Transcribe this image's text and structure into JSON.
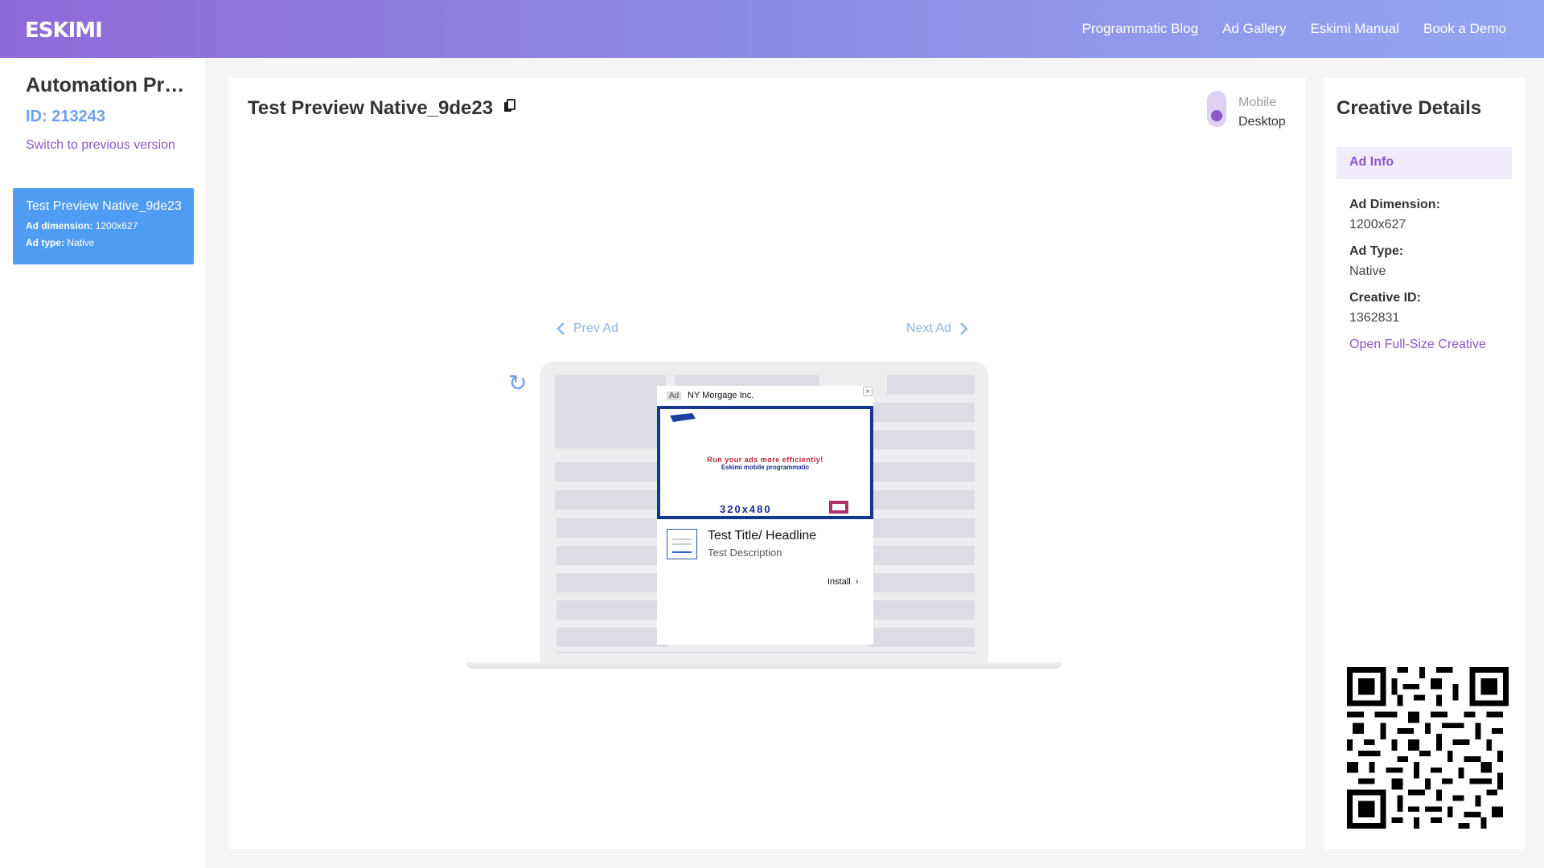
{
  "header": {
    "logo_text": "ESKIMI",
    "nav": [
      "Programmatic Blog",
      "Ad Gallery",
      "Eskimi Manual",
      "Book a Demo"
    ]
  },
  "sidebar": {
    "campaign_title": "Automation Project",
    "campaign_id": "ID: 213243",
    "switch_link": "Switch to previous version",
    "ads": [
      {
        "name": "Test Preview Native_9de23",
        "dimension_label": "Ad dimension:",
        "dimension": "1200x627",
        "type_label": "Ad type:",
        "type": "Native"
      }
    ]
  },
  "preview": {
    "title": "Test Preview Native_9de23",
    "device_options": [
      "Mobile",
      "Desktop"
    ],
    "selected_device": "Desktop",
    "prev_label": "Prev Ad",
    "next_label": "Next Ad"
  },
  "native_ad": {
    "badge": "Ad",
    "advertiser": "NY Morgage Inc.",
    "close": "×",
    "creative_line1": "Run your ads more efficiently!",
    "creative_line2": "Eskimi mobile programmatic",
    "creative_dims": "320x480",
    "headline": "Test Title/ Headline",
    "description": "Test Description",
    "cta": "Install"
  },
  "details": {
    "title": "Creative Details",
    "tab": "Ad Info",
    "fields": [
      {
        "label": "Ad Dimension:",
        "value": "1200x627"
      },
      {
        "label": "Ad Type:",
        "value": "Native"
      },
      {
        "label": "Creative ID:",
        "value": "1362831"
      }
    ],
    "open_full": "Open Full-Size Creative"
  },
  "colors": {
    "brand_purple": "#8a58c7",
    "accent_blue": "#4f9cf5",
    "link_blue": "#6ea2e6"
  }
}
